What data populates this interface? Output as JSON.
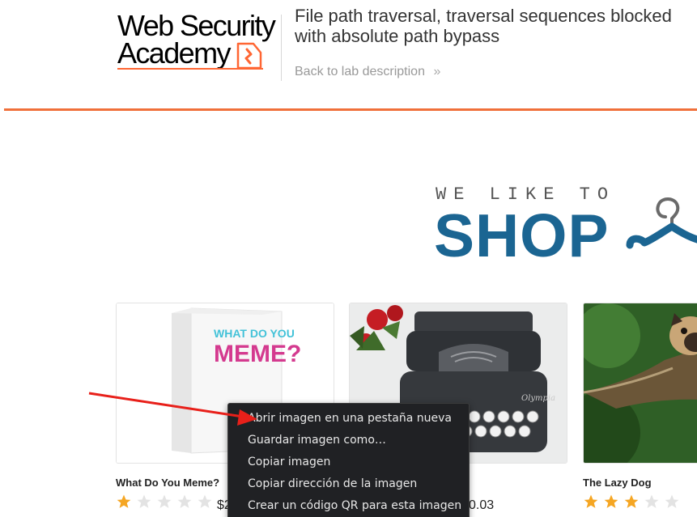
{
  "header": {
    "logo_line1": "Web Security",
    "logo_line2": "Academy",
    "lab_title": "File path traversal, traversal sequences blocked with absolute path bypass",
    "back_link": "Back to lab description",
    "accent_color": "#ff6633"
  },
  "hero": {
    "tagline": "WE LIKE TO",
    "headline": "SHOP",
    "headline_color": "#1b6592"
  },
  "products": [
    {
      "name": "What Do You Meme?",
      "rating": 1,
      "price": "$2",
      "image_text_1": "WHAT DO YOU",
      "image_text_2": "MEME?"
    },
    {
      "name": "",
      "rating": null,
      "price": "0.03"
    },
    {
      "name": "The Lazy Dog",
      "rating": 3,
      "price": ""
    }
  ],
  "context_menu": {
    "items": [
      "Abrir imagen en una pestaña nueva",
      "Guardar imagen como…",
      "Copiar imagen",
      "Copiar dirección de la imagen",
      "Crear un código QR para esta imagen"
    ],
    "background": "#202124"
  },
  "colors": {
    "star_filled": "#f5a623",
    "star_empty": "#e3e3e3",
    "annotation_arrow": "#e8201a"
  }
}
